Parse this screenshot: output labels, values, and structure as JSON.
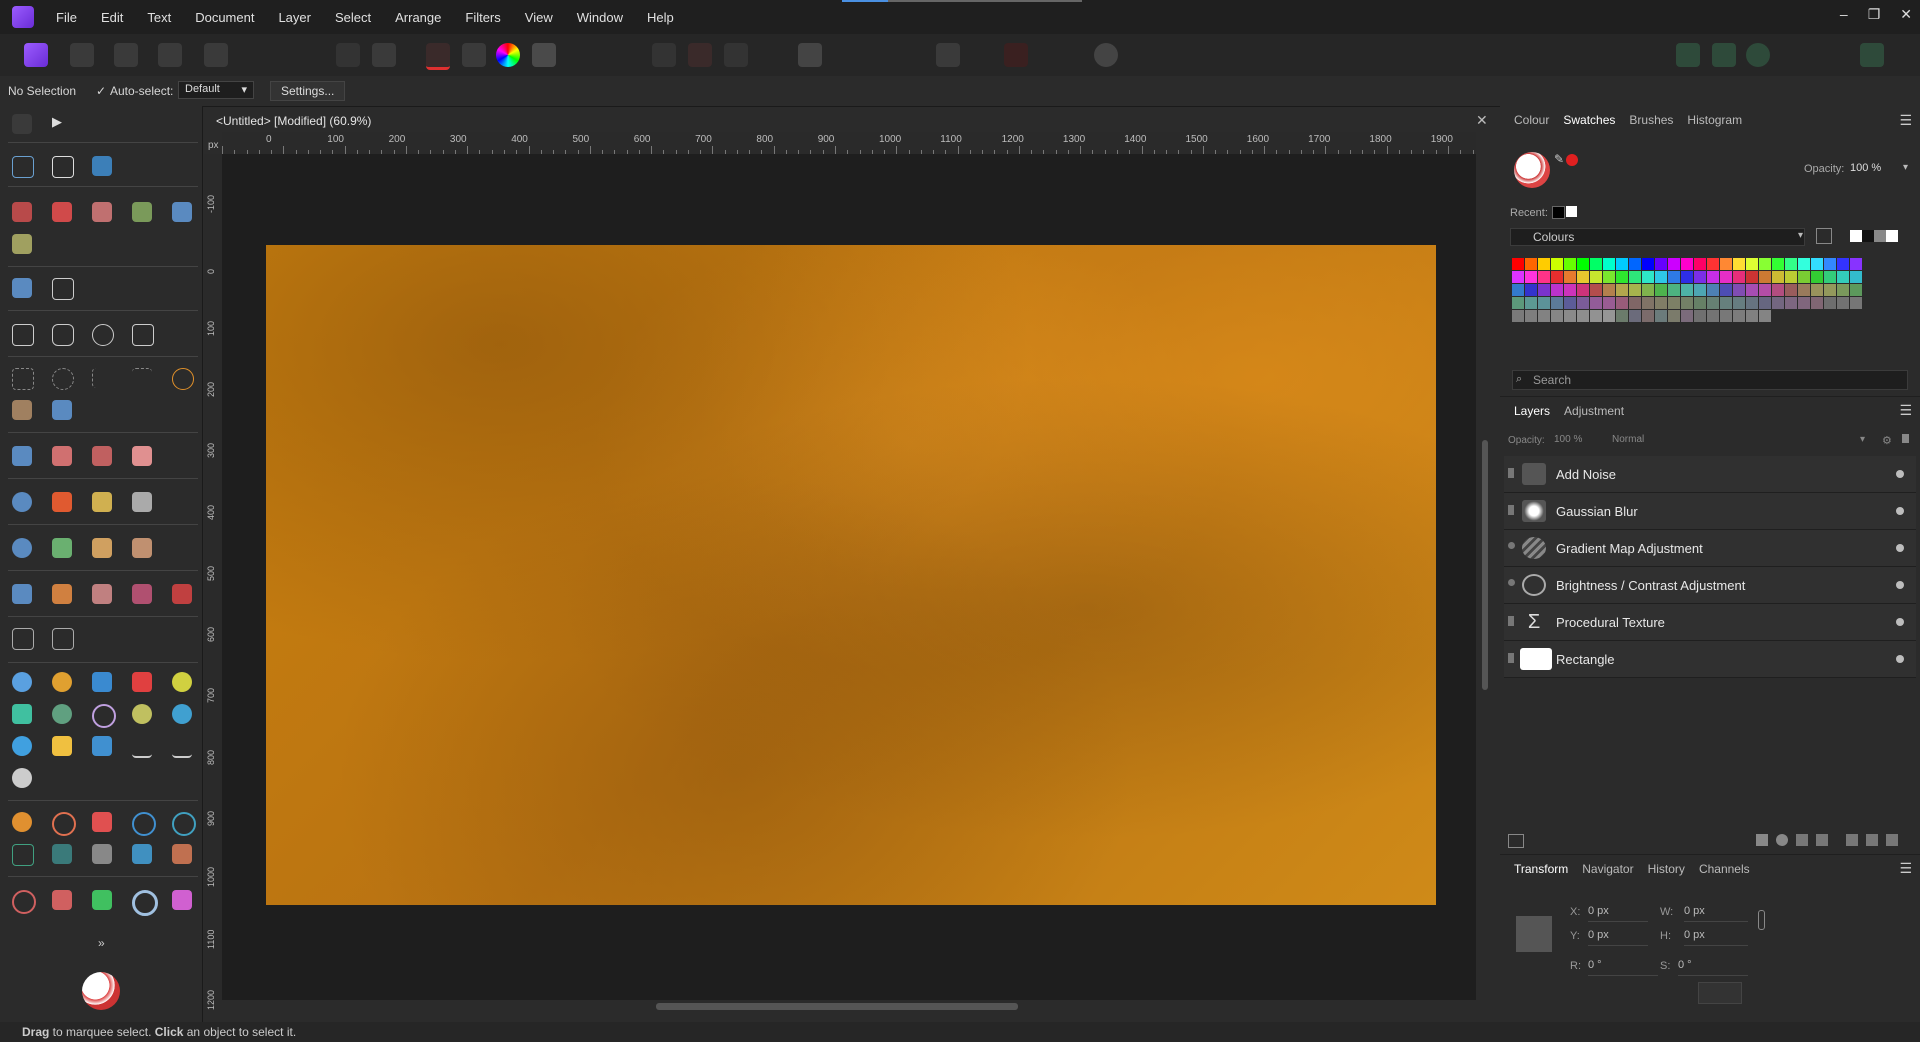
{
  "menubar": {
    "items": [
      "File",
      "Edit",
      "Text",
      "Document",
      "Layer",
      "Select",
      "Arrange",
      "Filters",
      "View",
      "Window",
      "Help"
    ],
    "window_controls": [
      "–",
      "❐",
      "✕"
    ]
  },
  "context": {
    "selection_status": "No Selection",
    "autoselect_label": "Auto-select:",
    "autoselect_value": "Default",
    "settings_button": "Settings..."
  },
  "document": {
    "tab_title": "<Untitled> [Modified] (60.9%)",
    "ruler_unit": "px",
    "ruler_top_ticks": [
      "0",
      "100",
      "200",
      "300",
      "400",
      "500",
      "600",
      "700",
      "800",
      "900",
      "1000",
      "1100",
      "1200",
      "1300",
      "1400",
      "1500",
      "1600",
      "1700",
      "1800",
      "1900"
    ],
    "ruler_left_ticks": [
      "-100",
      "0",
      "100",
      "200",
      "300",
      "400",
      "500",
      "600",
      "700",
      "800",
      "900",
      "1000",
      "1100",
      "1200"
    ]
  },
  "status": {
    "bold1": "Drag",
    "text1": " to marquee select. ",
    "bold2": "Click",
    "text2": " an object to select it."
  },
  "colour_panel": {
    "tabs": [
      "Colour",
      "Swatches",
      "Brushes",
      "Histogram"
    ],
    "active_tab": "Swatches",
    "opacity_label": "Opacity:",
    "opacity_value": "100 %",
    "recent_label": "Recent:",
    "palette_name": "Colours",
    "search_placeholder": "Search"
  },
  "swatches": [
    "#ff0000",
    "#ff6600",
    "#ffcc00",
    "#ccff00",
    "#66ff00",
    "#00ff00",
    "#00ff66",
    "#00ffcc",
    "#00ccff",
    "#0066ff",
    "#0000ff",
    "#6600ff",
    "#cc00ff",
    "#ff00cc",
    "#ff0066",
    "#ff3333",
    "#ff8833",
    "#ffdd33",
    "#ddff33",
    "#88ff33",
    "#33ff33",
    "#33ff88",
    "#33ffdd",
    "#33ddff",
    "#3388ff",
    "#3333ff",
    "#8833ff",
    "#dd33ff",
    "#ff33dd",
    "#ff3388",
    "#e62e2e",
    "#e67a2e",
    "#e6c72e",
    "#c7e62e",
    "#7ae62e",
    "#2ee62e",
    "#2ee67a",
    "#2ee6c7",
    "#2ec7e6",
    "#2e7ae6",
    "#2e2ee6",
    "#7a2ee6",
    "#c72ee6",
    "#e62ec7",
    "#e62e7a",
    "#cc3333",
    "#cc7a33",
    "#ccbb33",
    "#bbcc33",
    "#7acc33",
    "#33cc33",
    "#33cc7a",
    "#33ccbb",
    "#33bbcc",
    "#337acc",
    "#3333cc",
    "#7a33cc",
    "#bb33cc",
    "#cc33bb",
    "#cc337a",
    "#b34d4d",
    "#b3804d",
    "#b3a64d",
    "#a6b34d",
    "#80b34d",
    "#4db34d",
    "#4db380",
    "#4db3a6",
    "#4da6b3",
    "#4d80b3",
    "#4d4db3",
    "#804db3",
    "#a64db3",
    "#b34da6",
    "#b34d80",
    "#995c5c",
    "#997a5c",
    "#99935c",
    "#93995c",
    "#7a995c",
    "#5c995c",
    "#5c997a",
    "#5c9993",
    "#5c9399",
    "#5c7a99",
    "#5c5c99",
    "#7a5c99",
    "#935c99",
    "#995c93",
    "#995c7a",
    "#806666",
    "#807366",
    "#807d66",
    "#7d8066",
    "#738066",
    "#668066",
    "#668073",
    "#66807d",
    "#667d80",
    "#667380",
    "#666680",
    "#736680",
    "#7d6680",
    "#80667d",
    "#806673",
    "#6e6e6e",
    "#727272",
    "#767676",
    "#7a7a7a",
    "#7e7e7e",
    "#828282",
    "#868686",
    "#8a8a8a",
    "#8e8e8e",
    "#929292",
    "#969696",
    "#6b7b6b",
    "#6b6b7b",
    "#7b6b6b",
    "#6b7b7b",
    "#7b7b6b",
    "#7b6b7b",
    "#707070",
    "#747474",
    "#787878",
    "#7c7c7c",
    "#808080",
    "#848484"
  ],
  "layers_panel": {
    "tabs": [
      "Layers",
      "Adjustment"
    ],
    "opacity_label": "Opacity:",
    "opacity_value": "100 %",
    "blend_mode": "Normal",
    "layers": [
      {
        "name": "Add Noise"
      },
      {
        "name": "Gaussian Blur"
      },
      {
        "name": "Gradient Map Adjustment"
      },
      {
        "name": "Brightness / Contrast Adjustment"
      },
      {
        "name": "Procedural Texture"
      },
      {
        "name": "Rectangle"
      }
    ]
  },
  "transform_panel": {
    "tabs": [
      "Transform",
      "Navigator",
      "History",
      "Channels"
    ],
    "x_label": "X:",
    "x_value": "0 px",
    "y_label": "Y:",
    "y_value": "0 px",
    "w_label": "W:",
    "w_value": "0 px",
    "h_label": "H:",
    "h_value": "0 px",
    "r_label": "R:",
    "r_value": "0 °",
    "s_label": "S:",
    "s_value": "0 °"
  },
  "colors": {
    "accent": "#9b5cff",
    "canvas_orange": "#c47d14"
  }
}
